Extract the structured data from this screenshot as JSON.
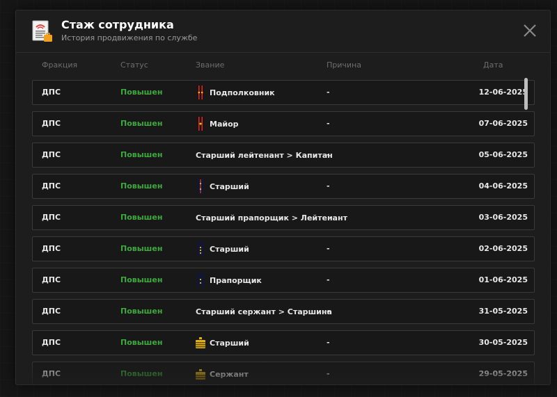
{
  "modal": {
    "title": "Стаж сотрудника",
    "subtitle": "История продвижения по службе"
  },
  "columns": {
    "faction": "Фракция",
    "status": "Статус",
    "rank": "Звание",
    "reason": "Причина",
    "date": "Дата"
  },
  "rows": [
    {
      "faction": "ДПС",
      "status": "Повышен",
      "rank": "Подполковник",
      "rank_icon": "lieutenant-colonel-shoulder-strap-icon",
      "reason": "-",
      "date": "12-06-2025"
    },
    {
      "faction": "ДПС",
      "status": "Повышен",
      "rank": "Майор",
      "rank_icon": "major-shoulder-strap-icon",
      "reason": "-",
      "date": "07-06-2025"
    },
    {
      "faction": "ДПС",
      "status": "Повышен",
      "rank": "Старший лейтенант > Капитан",
      "rank_icon": "",
      "reason": "-",
      "date": "05-06-2025"
    },
    {
      "faction": "ДПС",
      "status": "Повышен",
      "rank": "Старший",
      "rank_icon": "senior-lieutenant-shoulder-strap-icon",
      "reason": "-",
      "date": "04-06-2025"
    },
    {
      "faction": "ДПС",
      "status": "Повышен",
      "rank": "Старший прапорщик > Лейтенант",
      "rank_icon": "",
      "reason": "-",
      "date": "03-06-2025"
    },
    {
      "faction": "ДПС",
      "status": "Повышен",
      "rank": "Старший",
      "rank_icon": "senior-warrant-officer-shoulder-strap-icon",
      "reason": "-",
      "date": "02-06-2025"
    },
    {
      "faction": "ДПС",
      "status": "Повышен",
      "rank": "Прапорщик",
      "rank_icon": "warrant-officer-shoulder-strap-icon",
      "reason": "-",
      "date": "01-06-2025"
    },
    {
      "faction": "ДПС",
      "status": "Повышен",
      "rank": "Старший сержант > Старшина",
      "rank_icon": "",
      "reason": "-",
      "date": "31-05-2025"
    },
    {
      "faction": "ДПС",
      "status": "Повышен",
      "rank": "Старший",
      "rank_icon": "senior-sergeant-shoulder-strap-icon",
      "reason": "-",
      "date": "30-05-2025"
    },
    {
      "faction": "ДПС",
      "status": "Повышен",
      "rank": "Сержант",
      "rank_icon": "sergeant-shoulder-strap-icon",
      "reason": "-",
      "date": "29-05-2025"
    }
  ],
  "colors": {
    "status_promoted": "#3fa83f",
    "officer_strap": "#6b1f2a",
    "junior_officer_strap": "#1a1f4a",
    "sergeant_strap": "#e0b21a"
  },
  "icons": {
    "header": "document-badge-icon",
    "close": "close-icon"
  }
}
